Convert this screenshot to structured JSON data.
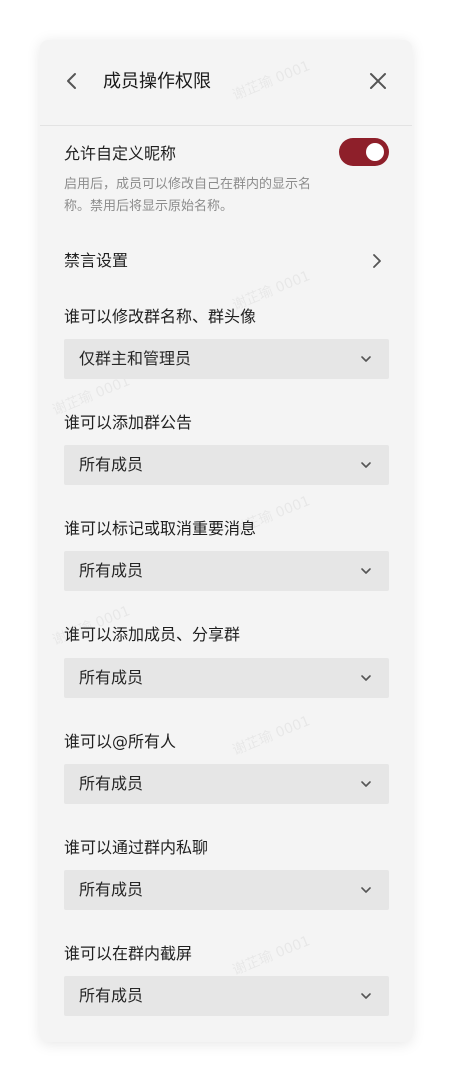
{
  "header": {
    "title": "成员操作权限",
    "back_icon": "chevron-left-icon",
    "close_icon": "close-icon"
  },
  "nickname": {
    "label": "允许自定义昵称",
    "description": "启用后，成员可以修改自己在群内的显示名称。禁用后将显示原始名称。",
    "enabled": true
  },
  "mute": {
    "label": "禁言设置",
    "icon": "chevron-right-icon"
  },
  "permissions": [
    {
      "label": "谁可以修改群名称、群头像",
      "value": "仅群主和管理员"
    },
    {
      "label": "谁可以添加群公告",
      "value": "所有成员"
    },
    {
      "label": "谁可以标记或取消重要消息",
      "value": "所有成员"
    },
    {
      "label": "谁可以添加成员、分享群",
      "value": "所有成员"
    },
    {
      "label": "谁可以@所有人",
      "value": "所有成员"
    },
    {
      "label": "谁可以通过群内私聊",
      "value": "所有成员"
    },
    {
      "label": "谁可以在群内截屏",
      "value": "所有成员"
    }
  ],
  "watermark": "谢芷瑜 0001",
  "colors": {
    "accent": "#8e1f2a",
    "panel_bg": "#f4f4f4",
    "select_bg": "#e6e6e6",
    "muted_text": "#8c8c8c"
  }
}
